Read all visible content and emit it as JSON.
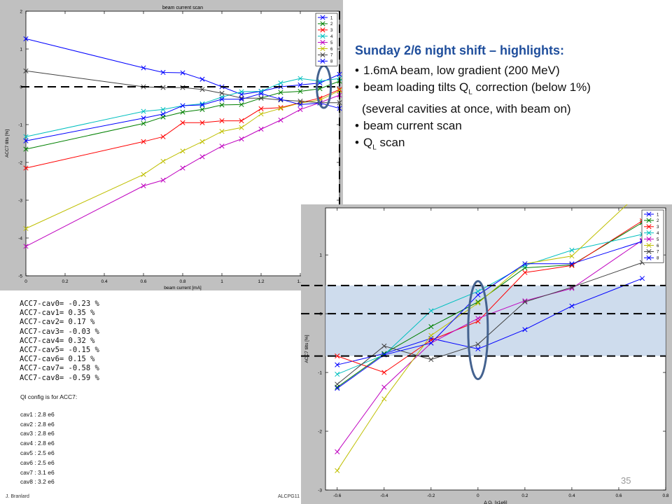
{
  "highlights": {
    "title": "Sunday 2/6 night shift – highlights:",
    "b1": "1.6mA beam, low gradient (200 MeV)",
    "b2_pre": "beam loading tilts Q",
    "b2_sub": "L",
    "b2_post": " correction (below 1%)",
    "b3": "(several cavities at once, with beam on)",
    "b4": "beam current scan",
    "b5_pre": "Q",
    "b5_sub": "L",
    "b5_post": " scan"
  },
  "readout": [
    "ACC7-cav0= -0.23 %",
    "ACC7-cav1= 0.35 %",
    "ACC7-cav2= 0.17 %",
    "ACC7-cav3= -0.03 %",
    "ACC7-cav4= 0.32 %",
    "ACC7-cav5= -0.15 %",
    "ACC7-cav6= 0.15 %",
    "ACC7-cav7= -0.58 %",
    "ACC7-cav8= -0.59 %"
  ],
  "ql_config": {
    "header": "Ql config is for ACC7:",
    "items": [
      "cav1 : 2.8 e6",
      "cav2 : 2.8 e6",
      "cav3 : 2.8 e6",
      "cav4 : 2.8 e6",
      "cav5 : 2.5 e6",
      "cav6 : 2.5 e6",
      "cav7 : 3.1 e6",
      "cav8 : 3.2 e6"
    ]
  },
  "footer": {
    "author": "J. Branlard",
    "event": "ALCPG11",
    "page": "35"
  },
  "chart_data": [
    {
      "type": "line",
      "title": "beam current scan",
      "xlabel": "beam current [mA]",
      "ylabel": "ACC7 tilts [%]",
      "xlim": [
        0,
        1.6
      ],
      "ylim": [
        -5,
        2
      ],
      "xticks": [
        "0",
        "0.2",
        "0.4",
        "0.6",
        "0.8",
        "1",
        "1.2",
        "1.4",
        "1.6"
      ],
      "yticks": [
        "-5",
        "-4",
        "-3",
        "-2",
        "-1",
        "0",
        "1",
        "2"
      ],
      "legend": "top-right",
      "grid": false,
      "x": [
        0,
        0.6,
        0.7,
        0.8,
        0.9,
        1.0,
        1.1,
        1.2,
        1.3,
        1.4,
        1.5,
        1.6
      ],
      "series": [
        {
          "name": "1",
          "color": "#0000ff",
          "values": [
            1.27,
            0.5,
            0.38,
            0.37,
            0.2,
            0.0,
            -0.2,
            -0.12,
            0.0,
            0.05,
            0.1,
            0.33
          ]
        },
        {
          "name": "2",
          "color": "#008000",
          "values": [
            -1.65,
            -0.97,
            -0.8,
            -0.67,
            -0.6,
            -0.48,
            -0.47,
            -0.3,
            -0.15,
            -0.12,
            -0.05,
            0.15
          ]
        },
        {
          "name": "3",
          "color": "#ff0000",
          "values": [
            -2.15,
            -1.45,
            -1.32,
            -0.95,
            -0.95,
            -0.9,
            -0.9,
            -0.58,
            -0.55,
            -0.42,
            -0.3,
            -0.07
          ]
        },
        {
          "name": "4",
          "color": "#00bfbf",
          "values": [
            -1.32,
            -0.65,
            -0.6,
            -0.5,
            -0.45,
            -0.27,
            -0.13,
            -0.12,
            0.1,
            0.22,
            0.15,
            0.22
          ]
        },
        {
          "name": "5",
          "color": "#bf00bf",
          "values": [
            -4.22,
            -2.62,
            -2.47,
            -2.15,
            -1.85,
            -1.57,
            -1.38,
            -1.12,
            -0.88,
            -0.6,
            -0.42,
            -0.22
          ]
        },
        {
          "name": "6",
          "color": "#bfbf00",
          "values": [
            -3.75,
            -2.32,
            -1.97,
            -1.7,
            -1.45,
            -1.18,
            -1.08,
            -0.72,
            -0.57,
            -0.43,
            -0.35,
            -0.1
          ]
        },
        {
          "name": "7",
          "color": "#404040",
          "values": [
            0.42,
            0.0,
            -0.02,
            -0.02,
            -0.07,
            -0.17,
            -0.3,
            -0.3,
            -0.35,
            -0.38,
            -0.42,
            -0.42
          ]
        },
        {
          "name": "8",
          "color": "#0000ff",
          "values": [
            -1.43,
            -0.83,
            -0.72,
            -0.5,
            -0.48,
            -0.33,
            -0.33,
            -0.18,
            -0.33,
            -0.47,
            -0.43,
            -0.57
          ]
        }
      ]
    },
    {
      "type": "line",
      "xlabel_pre": "Δ Q",
      "xlabel_sub": "L",
      "xlabel_post": " [x1e6]",
      "ylabel": "ACC7 tilts [%]",
      "xlim": [
        -0.65,
        0.8
      ],
      "ylim": [
        -3,
        1.8
      ],
      "xticks": [
        "-0.6",
        "-0.4",
        "-0.2",
        "0",
        "0.2",
        "0.4",
        "0.6",
        "0.8"
      ],
      "yticks": [
        "-3",
        "-2",
        "-1",
        "0",
        "1"
      ],
      "legend": "top-right",
      "grid": false,
      "x": [
        -0.6,
        -0.4,
        -0.2,
        0.0,
        0.2,
        0.4,
        0.7
      ],
      "series": [
        {
          "name": "1",
          "color": "#0000ff",
          "values": [
            -0.87,
            -0.68,
            -0.42,
            -0.6,
            -0.27,
            0.13,
            0.6
          ]
        },
        {
          "name": "2",
          "color": "#008000",
          "values": [
            -1.25,
            -0.68,
            -0.22,
            0.2,
            0.78,
            0.83,
            1.55
          ]
        },
        {
          "name": "3",
          "color": "#ff0000",
          "values": [
            -0.72,
            -1.0,
            -0.45,
            -0.13,
            0.7,
            0.82,
            1.58
          ]
        },
        {
          "name": "4",
          "color": "#00bfbf",
          "values": [
            -1.03,
            -0.7,
            0.05,
            0.38,
            0.82,
            1.08,
            1.35
          ]
        },
        {
          "name": "5",
          "color": "#bf00bf",
          "values": [
            -2.35,
            -1.25,
            -0.5,
            -0.08,
            0.22,
            0.43,
            1.25
          ]
        },
        {
          "name": "6",
          "color": "#bfbf00",
          "values": [
            -2.67,
            -1.45,
            -0.37,
            0.18,
            0.85,
            0.98,
            2.1
          ]
        },
        {
          "name": "7",
          "color": "#404040",
          "values": [
            -1.2,
            -0.55,
            -0.78,
            -0.52,
            0.2,
            0.45,
            0.87
          ]
        },
        {
          "name": "8",
          "color": "#0000ff",
          "values": [
            -1.27,
            -0.7,
            -0.5,
            0.32,
            0.85,
            0.85,
            1.23
          ]
        }
      ]
    }
  ]
}
